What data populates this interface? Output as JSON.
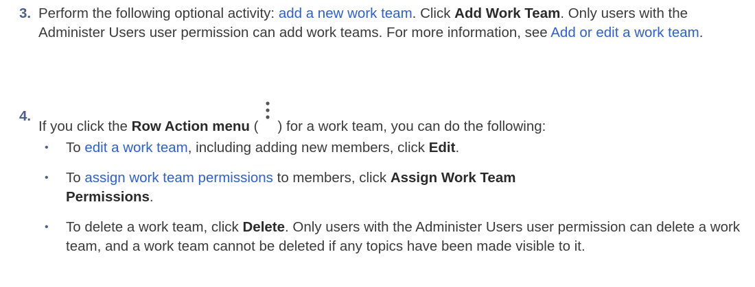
{
  "step3": {
    "number": "3.",
    "intro": "Perform the following optional activity: ",
    "link": "add a new work team",
    "mid": ". Click ",
    "button": "Add Work Team",
    "end": ". Only users with the Administer Users user permission can add work teams. For more information, see ",
    "link2": "Add or edit a work team",
    "tail": "."
  },
  "step4": {
    "number": "4.",
    "intro": "If you click the ",
    "menu": "Row Action menu",
    "paren_open": " (",
    "paren_close": ") for a work team, you can do the following:",
    "icon": "kebab-menu-icon"
  },
  "bullets": [
    {
      "pre": "To ",
      "link": "edit a work team",
      "mid": ", including adding new members, click ",
      "bold": "Edit",
      "post": "."
    },
    {
      "pre": "To ",
      "link": "assign work team permissions",
      "mid": " to members, click ",
      "bold": "Assign Work Team Permissions",
      "post": "."
    },
    {
      "pre": "To delete a work team, click ",
      "bold": "Delete",
      "post": ". Only users with the Administer Users user permission can delete a work team, and a work team cannot be deleted if any topics have been made visible to it."
    }
  ],
  "colors": {
    "link": "#2b5fd9",
    "text": "#3a3a3a",
    "number": "#4a5f8a"
  }
}
